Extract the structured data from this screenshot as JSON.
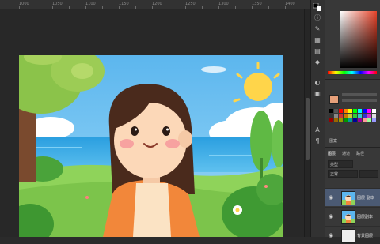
{
  "ruler": {
    "ticks": [
      "1000",
      "1050",
      "1100",
      "1150",
      "1200",
      "1250",
      "1300",
      "1350",
      "1400"
    ]
  },
  "tools": [
    {
      "name": "foreground-background-icon"
    },
    {
      "name": "info-icon"
    },
    {
      "name": "brush-settings-icon"
    },
    {
      "name": "swatches-icon"
    },
    {
      "name": "gradient-icon"
    },
    {
      "name": "shapes-icon"
    },
    {
      "name": "adjustments-icon"
    },
    {
      "name": "libraries-icon"
    },
    {
      "name": "character-icon"
    },
    {
      "name": "paragraph-icon"
    }
  ],
  "panels": {
    "color_tab": "颜色",
    "adjust_tab": "调整",
    "style_label": "浏览",
    "swatch_label": "图案",
    "layers_tab": "图层",
    "channels_tab": "通道",
    "paths_tab": "路径",
    "kind_filter": "类型",
    "blend_mode": "正常",
    "opacity_label": "不透明度",
    "fill_label": "填充"
  },
  "layers": [
    {
      "name": "图层 副本",
      "selected": true
    },
    {
      "name": "图层副本",
      "selected": false
    },
    {
      "name": "背景图层",
      "selected": false
    }
  ],
  "colors": {
    "accent_selected": "#4b5a73",
    "background": "#2b2b2b",
    "panel": "#383838"
  }
}
